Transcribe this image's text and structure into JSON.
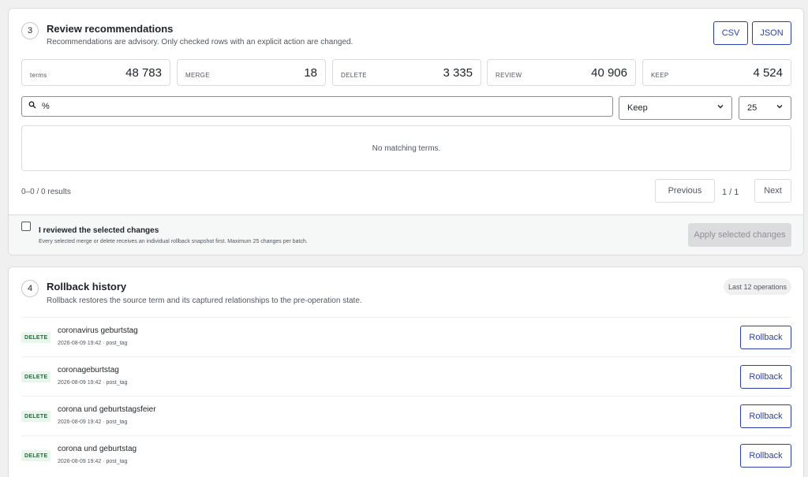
{
  "review": {
    "step": "3",
    "title": "Review recommendations",
    "subtitle": "Recommendations are advisory. Only checked rows with an explicit action are changed.",
    "csv_label": "CSV",
    "json_label": "JSON",
    "stats": [
      {
        "label": "terms",
        "value": "48 783"
      },
      {
        "label": "MERGE",
        "value": "18"
      },
      {
        "label": "DELETE",
        "value": "3 335"
      },
      {
        "label": "REVIEW",
        "value": "40 906"
      },
      {
        "label": "KEEP",
        "value": "4 524"
      }
    ],
    "search_value": "%",
    "action_filter": "Keep",
    "per_page": "25",
    "empty_message": "No matching terms.",
    "results_text": "0–0 / 0 results",
    "prev_label": "Previous",
    "page_info": "1 / 1",
    "next_label": "Next",
    "confirm_label": "I reviewed the selected changes",
    "confirm_note": "Every selected merge or delete receives an individual rollback snapshot first. Maximum 25 changes per batch.",
    "apply_label": "Apply selected changes"
  },
  "rollback": {
    "step": "4",
    "title": "Rollback history",
    "subtitle": "Rollback restores the source term and its captured relationships to the pre-operation state.",
    "pill": "Last 12 operations",
    "button_label": "Rollback",
    "operations": [
      {
        "action": "DELETE",
        "name": "coronavirus geburtstag",
        "meta": "2026-08-09 19:42 · post_tag"
      },
      {
        "action": "DELETE",
        "name": "coronageburtstag",
        "meta": "2026-08-09 19:42 · post_tag"
      },
      {
        "action": "DELETE",
        "name": "corona und geburtstagsfeier",
        "meta": "2026-08-09 19:42 · post_tag"
      },
      {
        "action": "DELETE",
        "name": "corona und geburtstag",
        "meta": "2026-08-09 19:42 · post_tag"
      }
    ]
  },
  "colors": {
    "accent": "#2c3fb1",
    "delete_badge_bg": "#e7f7ec",
    "delete_badge_text": "#0a7a2c"
  }
}
